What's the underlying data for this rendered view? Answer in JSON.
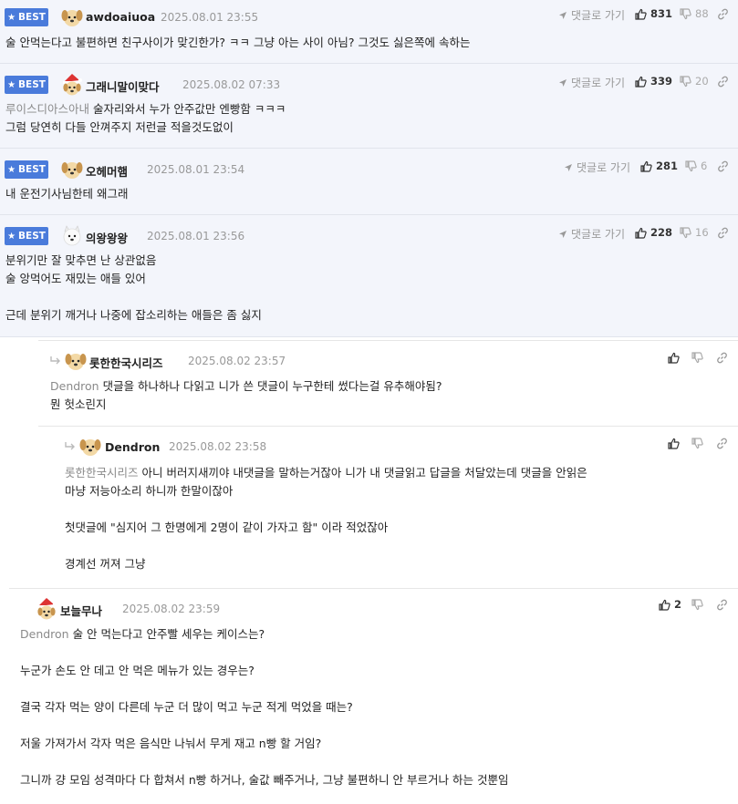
{
  "ui": {
    "best_label": "BEST",
    "goto_label": "댓글로 가기"
  },
  "comments": [
    {
      "nick": "awdoaiuoa",
      "date": "2025.08.01 23:55",
      "likes": "831",
      "dislikes": "88",
      "lines": [
        "술 안먹는다고 불편하면 친구사이가 맞긴한가? ㅋㅋ 그냥 아는 사이 아님? 그것도 싫은쪽에 속하는"
      ]
    },
    {
      "nick": "그래니말이맞다",
      "date": "2025.08.02 07:33",
      "likes": "339",
      "dislikes": "20",
      "mention": "루이스디아스아내",
      "lines": [
        " 술자리와서 누가 안주값만 엔빵함 ㅋㅋㅋ",
        "그럼 당연히 다들 안껴주지 저런글 적을것도없이"
      ]
    },
    {
      "nick": "오헤머햄",
      "date": "2025.08.01 23:54",
      "likes": "281",
      "dislikes": "6",
      "lines": [
        "내 운전기사님한테 왜그래"
      ]
    },
    {
      "nick": "의왕왕왕",
      "date": "2025.08.01 23:56",
      "likes": "228",
      "dislikes": "16",
      "lines": [
        "분위기만 잘 맞추면 난 상관없음",
        "술 앙먹어도 재밌는 애들 있어",
        "",
        "근데 분위기 깨거나 나중에 잡소리하는 애들은 좀 싫지"
      ]
    }
  ],
  "replies": [
    {
      "nick": "롯한한국시리즈",
      "date": "2025.08.02 23:57",
      "mention": "Dendron",
      "lines": [
        " 댓글을 하나하나 다읽고 니가 쓴 댓글이 누구한테 썼다는걸 유추해야됨?",
        "뭔 헛소린지"
      ]
    },
    {
      "nick": "Dendron",
      "date": "2025.08.02 23:58",
      "mention": "롯한한국시리즈",
      "lines": [
        " 아니 버러지새끼야 내댓글을 말하는거잖아 니가 내 댓글읽고 답글을 처달았는데 댓글을 안읽은",
        "마냥 저능아소리 하니까 한말이잖아",
        "",
        "첫댓글에 \"심지어 그 한명에게 2명이 같이 가자고 함\" 이라 적었잖아",
        "",
        "경계선 꺼져 그냥"
      ]
    },
    {
      "nick": "보늘무나",
      "date": "2025.08.02 23:59",
      "likes": "2",
      "mention": "Dendron",
      "lines": [
        " 술 안 먹는다고 안주빨 세우는 케이스는?",
        "",
        "누군가 손도 안 데고 안 먹은 메뉴가 있는 경우는?",
        "",
        "결국 각자 먹는 양이 다른데 누군 더 많이 먹고 누군 적게 먹었을 때는?",
        "",
        "저울 가져가서 각자 먹은 음식만 나눠서 무게 재고 n빵 할 거임?",
        "",
        "그니까 걍 모임 성격마다 다 합쳐서 n빵 하거나, 술값 빼주거나, 그냥 불편하니 안 부르거나 하는 것뿐임"
      ]
    }
  ],
  "icons": {
    "thumb_up": "thumbs-up-icon",
    "thumb_down": "thumbs-down-icon",
    "link": "link-icon",
    "arrow": "send-arrow-icon",
    "reply": "reply-arrow-icon"
  },
  "colors": {
    "best_bg": "#4a7bdb",
    "best_row_bg": "#f3f5fb",
    "mention": "#8a8a8a",
    "date": "#999999"
  }
}
